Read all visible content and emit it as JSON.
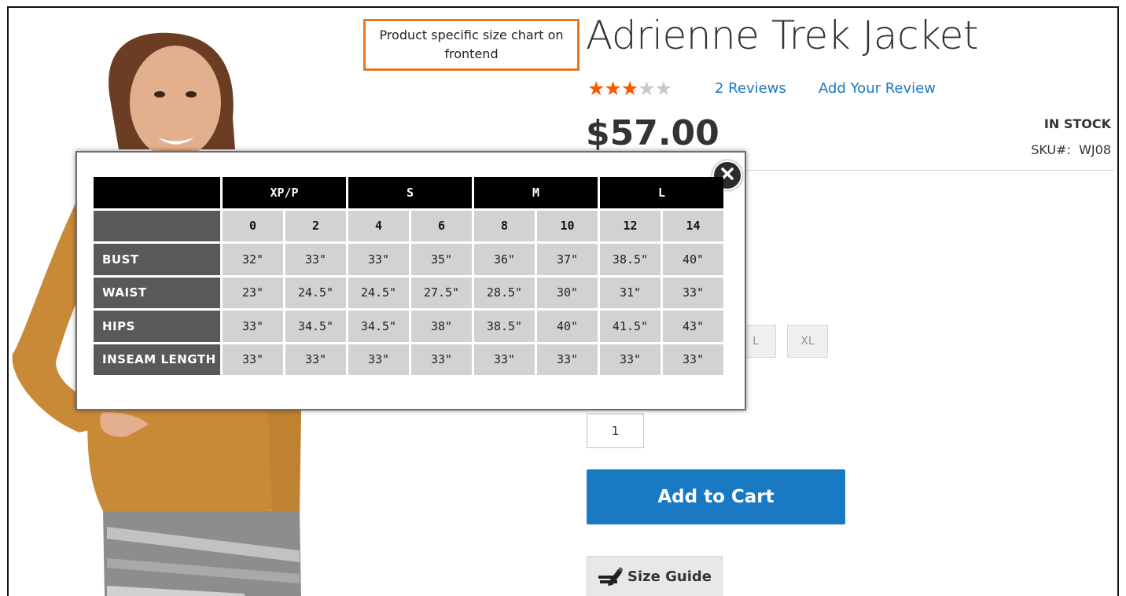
{
  "annotation": {
    "text": "Product specific size chart on frontend",
    "color": "#e87722"
  },
  "product": {
    "title": "Adrienne Trek Jacket",
    "rating": {
      "value": 3,
      "max": 5
    },
    "reviews_link": "2 Reviews",
    "add_review_link": "Add Your Review",
    "price": "$57.00",
    "stock_status": "IN STOCK",
    "sku_label": "SKU#:",
    "sku_value": "WJ08",
    "visible_sizes": [
      "L",
      "XL"
    ],
    "quantity": "1",
    "add_to_cart_label": "Add to Cart",
    "size_guide_label": "Size Guide"
  },
  "size_chart": {
    "groups": [
      "XP/P",
      "S",
      "M",
      "L"
    ],
    "sizes": [
      "0",
      "2",
      "4",
      "6",
      "8",
      "10",
      "12",
      "14"
    ],
    "rows": [
      {
        "label": "BUST",
        "values": [
          "32\"",
          "33\"",
          "33\"",
          "35\"",
          "36\"",
          "37\"",
          "38.5\"",
          "40\""
        ]
      },
      {
        "label": "WAIST",
        "values": [
          "23\"",
          "24.5\"",
          "24.5\"",
          "27.5\"",
          "28.5\"",
          "30\"",
          "31\"",
          "33\""
        ]
      },
      {
        "label": "HIPS",
        "values": [
          "33\"",
          "34.5\"",
          "34.5\"",
          "38\"",
          "38.5\"",
          "40\"",
          "41.5\"",
          "43\""
        ]
      },
      {
        "label": "INSEAM LENGTH",
        "values": [
          "33\"",
          "33\"",
          "33\"",
          "33\"",
          "33\"",
          "33\"",
          "33\"",
          "33\""
        ]
      }
    ]
  },
  "colors": {
    "link": "#1979c3",
    "primary_button": "#1979c3",
    "star_filled": "#ff5501",
    "star_empty": "#c9c9c9",
    "chart_header": "#000000",
    "chart_label": "#595959",
    "chart_cell": "#d2d2d2"
  },
  "icons": {
    "close": "close-icon",
    "size_guide": "pencil-ruler-icon",
    "star": "star-icon"
  }
}
